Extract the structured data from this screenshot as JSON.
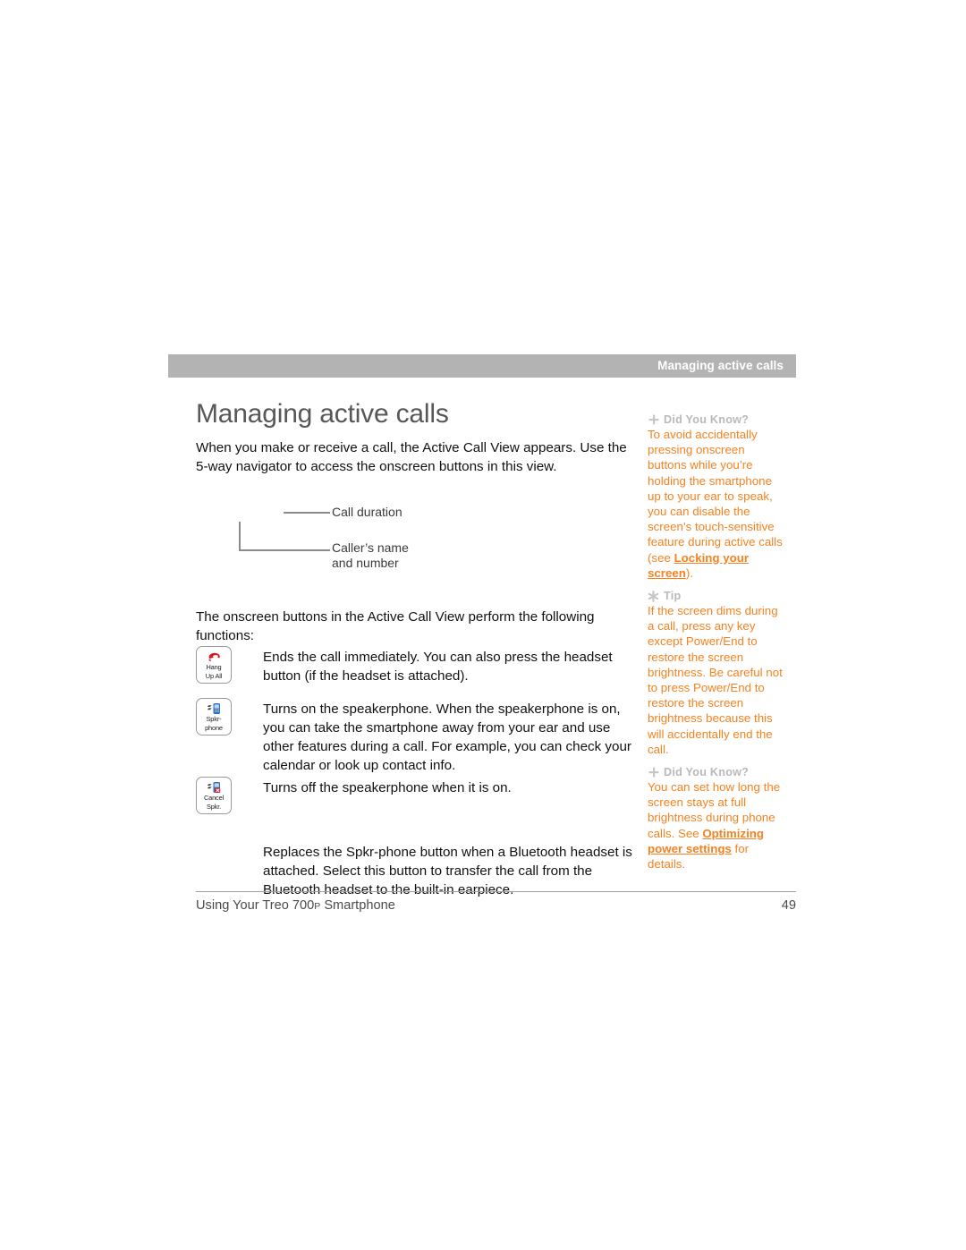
{
  "running_header": {
    "text": "Managing active calls"
  },
  "main": {
    "title": "Managing active calls",
    "intro": "When you make or receive a call, the Active Call View appears. Use the 5-way navigator to access the onscreen buttons in this view.",
    "buttons_intro": "The onscreen buttons in the Active Call View perform the following functions:",
    "callout": {
      "duration_label": "Call duration",
      "caller_label_line1": "Caller’s name",
      "caller_label_line2": "and number"
    },
    "button_rows": [
      {
        "icon_name": "hang-up-all-button-icon",
        "caption_line1": "Hang",
        "caption_line2": "Up All",
        "description": "Ends the call immediately. You can also press the headset button (if the headset is attached)."
      },
      {
        "icon_name": "speakerphone-button-icon",
        "caption_line1": "Spkr-",
        "caption_line2": "phone",
        "description": "Turns on the speakerphone. When the speakerphone is on, you can take the smartphone away from your ear and use other features during a call. For example, you can check your calendar or look up contact info."
      },
      {
        "icon_name": "cancel-speakerphone-button-icon",
        "caption_line1": "Cancel",
        "caption_line2": "Spkr.",
        "description": "Turns off the speakerphone when it is on."
      },
      {
        "icon_name": "bluetooth-transfer-button-icon",
        "caption_line1": "",
        "caption_line2": "",
        "description": "Replaces the Spkr-phone button when a Bluetooth headset is attached. Select this button to transfer the call from the Bluetooth headset to the built-in earpiece."
      }
    ]
  },
  "sidebar": {
    "blocks": [
      {
        "icon": "plus-icon",
        "heading": "Did You Know?",
        "text_before": "To avoid accidentally pressing onscreen buttons while you’re holding the smartphone up to your ear to speak, you can disable the screen’s touch-sensitive feature during active calls (see ",
        "link": "Locking your screen",
        "text_after": ")."
      },
      {
        "icon": "asterisk-icon",
        "heading": "Tip",
        "text_before": "If the screen dims during a call, press any key except Power/End to restore the screen brightness. Be careful not to press Power/End to restore the screen brightness because this will accidentally end the call.",
        "link": "",
        "text_after": ""
      },
      {
        "icon": "plus-icon",
        "heading": "Did You Know?",
        "text_before": "You can set how long the screen stays at full brightness during phone calls. See ",
        "link": "Optimizing power settings",
        "text_after": " for details."
      }
    ]
  },
  "footer": {
    "title_before": "Using Your Treo 700",
    "title_smallcap": "P",
    "title_after": " Smartphone",
    "page_number": "49"
  },
  "colors": {
    "accent_orange": "#f58220",
    "header_bar_gray": "#b3b3b3",
    "heading_gray": "#575757",
    "sidebar_head_gray": "#b9b9b9"
  }
}
